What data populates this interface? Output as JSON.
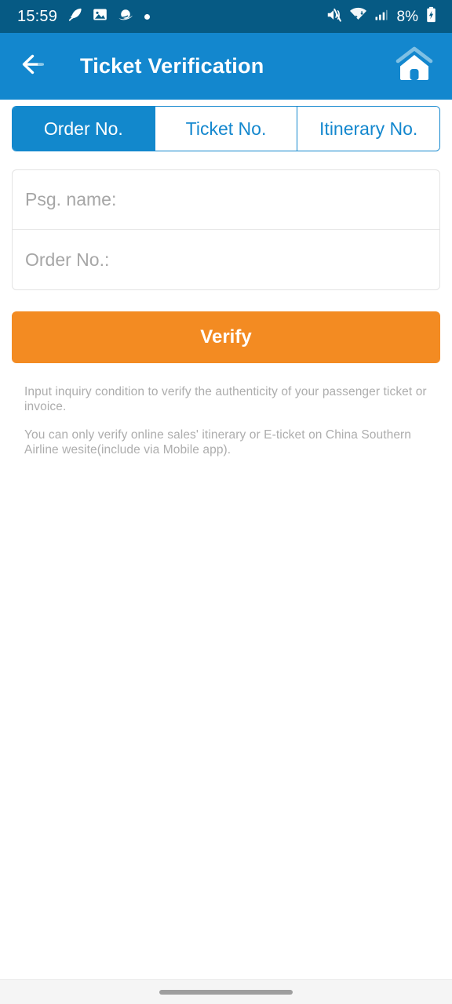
{
  "status_bar": {
    "clock": "15:59",
    "battery_percent": "8%",
    "left_icons": [
      "feather-icon",
      "photo-icon",
      "planet-icon",
      "dot-indicator-icon"
    ],
    "right_icons": [
      "volume-mute-icon",
      "wifi-icon",
      "cellular-signal-icon",
      "battery-charging-icon"
    ],
    "background_color": "#065A84"
  },
  "header": {
    "title": "Ticket Verification",
    "back_icon": "arrow-left-icon",
    "home_icon": "home-icon",
    "background_color": "#1387CE"
  },
  "tabs": {
    "items": [
      {
        "label": "Order No.",
        "active": true
      },
      {
        "label": "Ticket No.",
        "active": false
      },
      {
        "label": "Itinerary No.",
        "active": false
      }
    ],
    "active_color": "#1288CC",
    "inactive_text_color": "#1387CE"
  },
  "form": {
    "fields": [
      {
        "placeholder": "Psg. name:",
        "value": ""
      },
      {
        "placeholder": "Order No.:",
        "value": ""
      }
    ],
    "submit_label": "Verify",
    "submit_color": "#F38B22"
  },
  "notes": [
    "Input inquiry condition to verify the authenticity of your passenger ticket or invoice.",
    "You can only verify online sales' itinerary or E-ticket on China Southern Airline wesite(include via Mobile app)."
  ],
  "nav_bar": {
    "gesture_icon": "gesture-pill-icon"
  }
}
